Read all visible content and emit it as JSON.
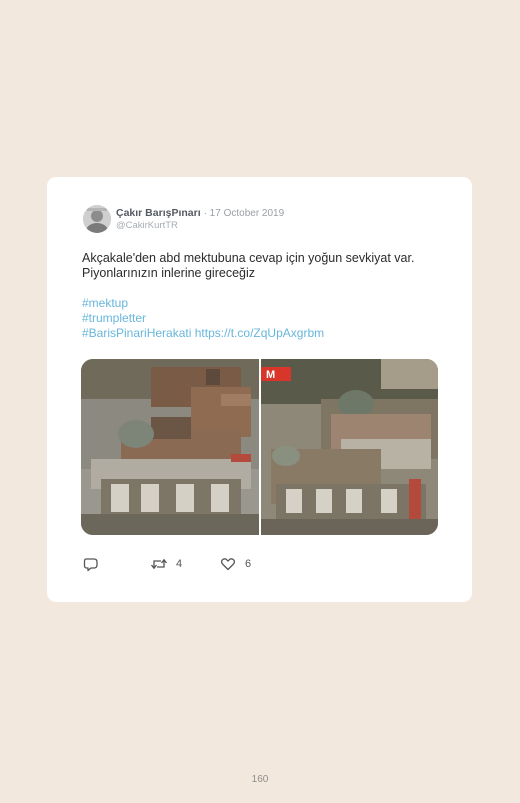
{
  "tweet": {
    "display_name": "Çakır BarışPınarı",
    "date": "· 17 October 2019",
    "handle": "@CakirKurtTR",
    "text_line1": "Akçakale'den abd mektubuna cevap için yoğun sevkiyat var.",
    "text_line2": "Piyonlarınızın inlerine gireceğiz",
    "hashtag1": "#mektup",
    "hashtag2": "#trumpletter",
    "hashtag3": "#BarisPinariHerakati",
    "link": "https://t.co/ZqUpAxgrbm",
    "retweet_count": "4",
    "like_count": "6",
    "news_logo_text": "M"
  },
  "icons": {
    "reply": "reply-icon",
    "retweet": "retweet-icon",
    "like": "heart-icon"
  },
  "page": {
    "number": "160"
  }
}
